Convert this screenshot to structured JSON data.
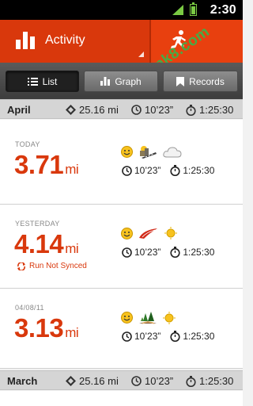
{
  "status_bar": {
    "time": "2:30",
    "watermark": "apk8.com"
  },
  "top_nav": {
    "activity_label": "Activity"
  },
  "segments": {
    "list": "List",
    "graph": "Graph",
    "records": "Records"
  },
  "months": [
    {
      "name": "April",
      "distance": "25.16 mi",
      "pace": "10’23”",
      "duration": "1:25:30"
    },
    {
      "name": "March",
      "distance": "25.16 mi",
      "pace": "10’23”",
      "duration": "1:25:30"
    }
  ],
  "runs": [
    {
      "date": "TODAY",
      "distance": "3.71",
      "unit": "mi",
      "pace": "10’23”",
      "duration": "1:25:30",
      "sync": "",
      "mood": "happy-icon",
      "terrain": "road-icon",
      "weather": "cloud-icon"
    },
    {
      "date": "YESTERDAY",
      "distance": "4.14",
      "unit": "mi",
      "pace": "10’23”",
      "duration": "1:25:30",
      "sync": "Run Not Synced",
      "mood": "happy-icon",
      "terrain": "track-icon",
      "weather": "sun-icon"
    },
    {
      "date": "04/08/11",
      "distance": "3.13",
      "unit": "mi",
      "pace": "10’23”",
      "duration": "1:25:30",
      "sync": "",
      "mood": "happy-icon",
      "terrain": "trail-icon",
      "weather": "sun-icon"
    }
  ],
  "colors": {
    "accent": "#e8400f",
    "accent_dark": "#d9380c",
    "watermark": "#3bb34a"
  }
}
